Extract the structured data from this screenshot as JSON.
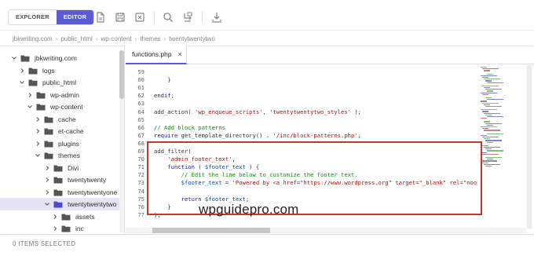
{
  "toolbar": {
    "explorer_label": "EXPLORER",
    "editor_label": "EDITOR",
    "icons": [
      "new-file-icon",
      "save-icon",
      "close-file-icon",
      "search-icon",
      "replace-icon",
      "download-icon"
    ]
  },
  "breadcrumb": [
    "jbkwriting.com",
    "public_html",
    "wp-content",
    "themes",
    "twentytwentytwo"
  ],
  "tree": [
    {
      "label": "jbkwriting.com",
      "expanded": true
    },
    {
      "label": "logs",
      "expanded": false
    },
    {
      "label": "public_html",
      "expanded": true
    },
    {
      "label": "wp-admin",
      "expanded": false
    },
    {
      "label": "wp-content",
      "expanded": true
    },
    {
      "label": "cache",
      "expanded": false
    },
    {
      "label": "et-cache",
      "expanded": false
    },
    {
      "label": "plugins",
      "expanded": false
    },
    {
      "label": "themes",
      "expanded": true
    },
    {
      "label": "Divi",
      "expanded": false
    },
    {
      "label": "twentytwenty",
      "expanded": false
    },
    {
      "label": "twentytwentyone",
      "expanded": false
    },
    {
      "label": "twentytwentytwo",
      "expanded": true,
      "selected": true
    },
    {
      "label": "assets",
      "expanded": false
    },
    {
      "label": "inc",
      "expanded": false
    }
  ],
  "editor": {
    "tab_label": "functions.php",
    "tab_close": "×",
    "lines": [
      {
        "n": "59",
        "text": ""
      },
      {
        "n": "60",
        "text": "    }"
      },
      {
        "n": "61",
        "text": ""
      },
      {
        "n": "62",
        "text": "endif;"
      },
      {
        "n": "63",
        "text": ""
      },
      {
        "n": "64",
        "text": "add_action( 'wp_enqueue_scripts', 'twentytwentytwo_styles' );"
      },
      {
        "n": "65",
        "text": ""
      },
      {
        "n": "66",
        "text": "// Add block patterns"
      },
      {
        "n": "67",
        "text": "require get_template_directory() . '/inc/block-patterns.php';"
      },
      {
        "n": "68",
        "text": ""
      },
      {
        "n": "69",
        "text": "add_filter("
      },
      {
        "n": "70",
        "text": "    'admin_footer_text',"
      },
      {
        "n": "71",
        "text": "    function ( $footer_text ) {"
      },
      {
        "n": "72",
        "text": "        // Edit the line below to customize the footer text."
      },
      {
        "n": "73",
        "text": "        $footer_text = 'Powered by <a href=\"https://www.wordpress.org\" target=\"_blank\" rel=\"noopener\">Wor"
      },
      {
        "n": "74",
        "text": ""
      },
      {
        "n": "75",
        "text": "        return $footer_text;"
      },
      {
        "n": "76",
        "text": "    }"
      },
      {
        "n": "77",
        "text": ");"
      }
    ]
  },
  "watermark": "wpguidepro.com",
  "status": "0 ITEMS SELECTED",
  "colors": {
    "accent": "#5b5bd6",
    "highlight_border": "#c0392b",
    "selected_row": "#e4e4f4"
  }
}
